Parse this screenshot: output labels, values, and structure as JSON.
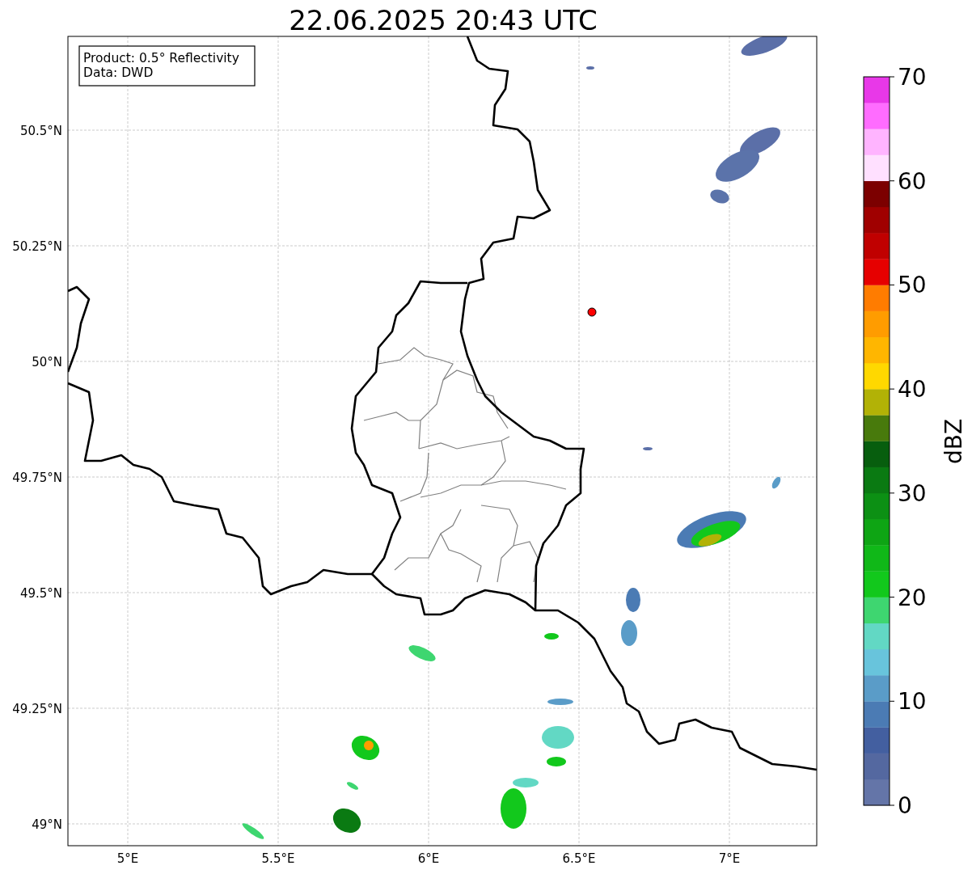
{
  "title": "22.06.2025 20:43 UTC",
  "info_box": [
    "Product: 0.5° Reflectivity",
    "Data: DWD"
  ],
  "lat_ticks": [
    "50.5°N",
    "50.25°N",
    "50°N",
    "49.75°N",
    "49.5°N",
    "49.25°N",
    "49°N"
  ],
  "lon_ticks": [
    "5°E",
    "5.5°E",
    "6°E",
    "6.5°E",
    "7°E"
  ],
  "colorbar": {
    "label": "dBZ",
    "ticks": [
      "70",
      "60",
      "50",
      "40",
      "30",
      "20",
      "10",
      "0"
    ],
    "segments": [
      {
        "color": "#6475a8"
      },
      {
        "color": "#5468a0"
      },
      {
        "color": "#435fa0"
      },
      {
        "color": "#4b7bb4"
      },
      {
        "color": "#5a9cc8"
      },
      {
        "color": "#68c4dc"
      },
      {
        "color": "#62d8c4"
      },
      {
        "color": "#3ed670"
      },
      {
        "color": "#12c81c"
      },
      {
        "color": "#10b818"
      },
      {
        "color": "#0ea514"
      },
      {
        "color": "#0c9014"
      },
      {
        "color": "#0a7a12"
      },
      {
        "color": "#075e0e"
      },
      {
        "color": "#487a0c"
      },
      {
        "color": "#b2b206"
      },
      {
        "color": "#ffd800"
      },
      {
        "color": "#ffb600"
      },
      {
        "color": "#ff9c00"
      },
      {
        "color": "#ff7c00"
      },
      {
        "color": "#e60000"
      },
      {
        "color": "#c00000"
      },
      {
        "color": "#a00000"
      },
      {
        "color": "#7c0000"
      },
      {
        "color": "#ffe0ff"
      },
      {
        "color": "#ffb4ff"
      },
      {
        "color": "#ff6cff"
      },
      {
        "color": "#e838e8"
      }
    ]
  }
}
